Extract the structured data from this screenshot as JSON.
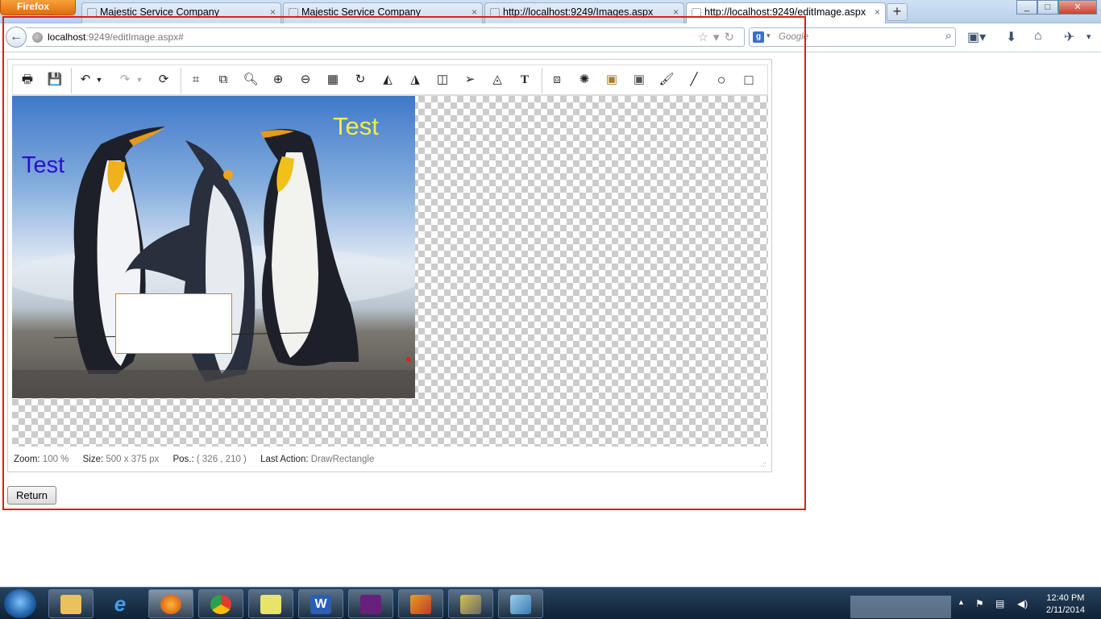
{
  "browser": {
    "menu_label": "Firefox",
    "tabs": [
      {
        "title": "Majestic Service Company",
        "close": "×"
      },
      {
        "title": "Majestic Service Company",
        "close": "×"
      },
      {
        "title": "http://localhost:9249/Images.aspx",
        "close": "×"
      },
      {
        "title": "http://localhost:9249/editImage.aspx",
        "close": "×"
      }
    ],
    "new_tab": "+",
    "url_host": "localhost",
    "url_rest": ":9249/editImage.aspx#",
    "search_placeholder": "Google",
    "search_engine_icon": "g",
    "window_controls": [
      "_",
      "□",
      "✕"
    ]
  },
  "editor": {
    "toolbar_icons": [
      "print-icon",
      "save-icon",
      "undo-icon",
      "dropdown-icon",
      "redo-icon",
      "dropdown-icon",
      "refresh-icon",
      "crop-icon",
      "resize-icon",
      "zoom-icon",
      "zoom-in-icon",
      "zoom-out-icon",
      "fit-icon",
      "rotate-icon",
      "flip-horizontal-icon",
      "flip-vertical-icon",
      "mirror-icon",
      "arrow-icon",
      "skew-icon",
      "text-icon",
      "layers-icon",
      "effects-icon",
      "sepia-icon",
      "grayscale-icon",
      "brush-icon",
      "line-icon",
      "circle-icon",
      "rectangle-icon"
    ],
    "image_texts": [
      "Test",
      "Test"
    ],
    "status": {
      "zoom_label": "Zoom:",
      "zoom_value": "100 %",
      "size_label": "Size:",
      "size_value": "500 x 375 px",
      "pos_label": "Pos.:",
      "pos_value": "( 326 , 210 )",
      "action_label": "Last Action:",
      "action_value": "DrawRectangle"
    },
    "resize_grip": ".::"
  },
  "return_button": "Return",
  "taskbar": {
    "time": "12:40 PM",
    "date": "2/11/2014"
  }
}
